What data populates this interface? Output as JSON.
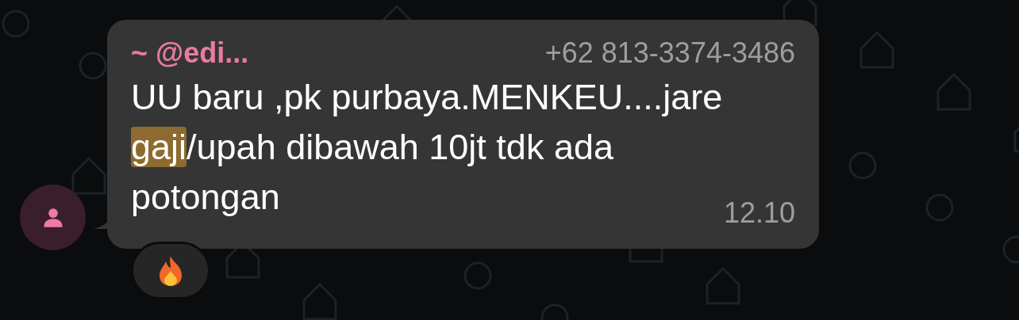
{
  "message": {
    "sender": "~ @edi...",
    "phone": "+62 813-3374-3486",
    "segments": [
      {
        "text": "UU baru ,pk purbaya.MENKEU....jare ",
        "highlighted": false
      },
      {
        "text": "gaji",
        "highlighted": true
      },
      {
        "text": "/upah dibawah 10jt tdk ada potongan",
        "highlighted": false
      }
    ],
    "time": "12.10"
  }
}
